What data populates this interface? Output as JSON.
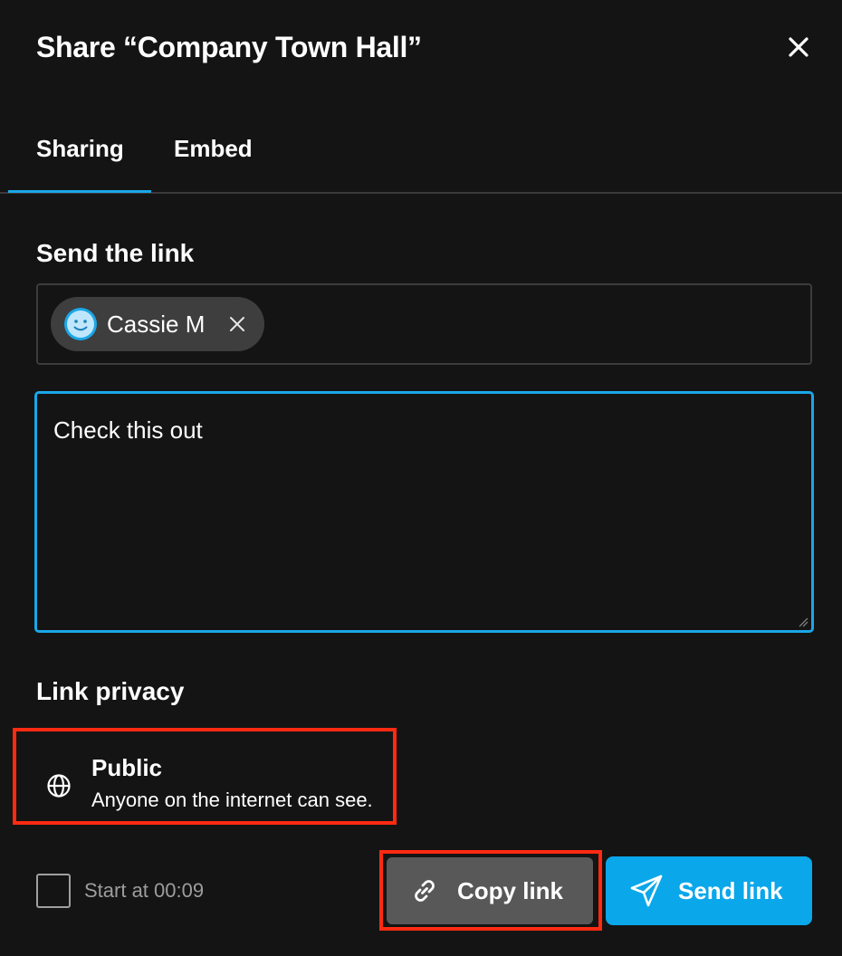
{
  "dialog": {
    "title": "Share “Company Town Hall”",
    "close_icon": "close-icon"
  },
  "tabs": [
    {
      "label": "Sharing",
      "active": true
    },
    {
      "label": "Embed",
      "active": false
    }
  ],
  "send_section": {
    "heading": "Send the link",
    "recipients": [
      {
        "name": "Cassie M",
        "avatar_icon": "smiley-avatar-icon",
        "remove_icon": "close-icon"
      }
    ],
    "message": "Check this out"
  },
  "privacy_section": {
    "heading": "Link privacy",
    "option": {
      "icon": "globe-icon",
      "title": "Public",
      "description": "Anyone on the internet can see."
    }
  },
  "footer": {
    "start_at_checked": false,
    "start_at_label": "Start at 00:09",
    "copy_link": {
      "label": "Copy link",
      "icon": "link-icon"
    },
    "send_link": {
      "label": "Send link",
      "icon": "paper-plane-icon"
    }
  },
  "colors": {
    "background": "#141414",
    "accent": "#0aa7ea",
    "highlight": "#ff2a12",
    "secondary_button": "#585858",
    "chip": "#3e3e3e"
  }
}
